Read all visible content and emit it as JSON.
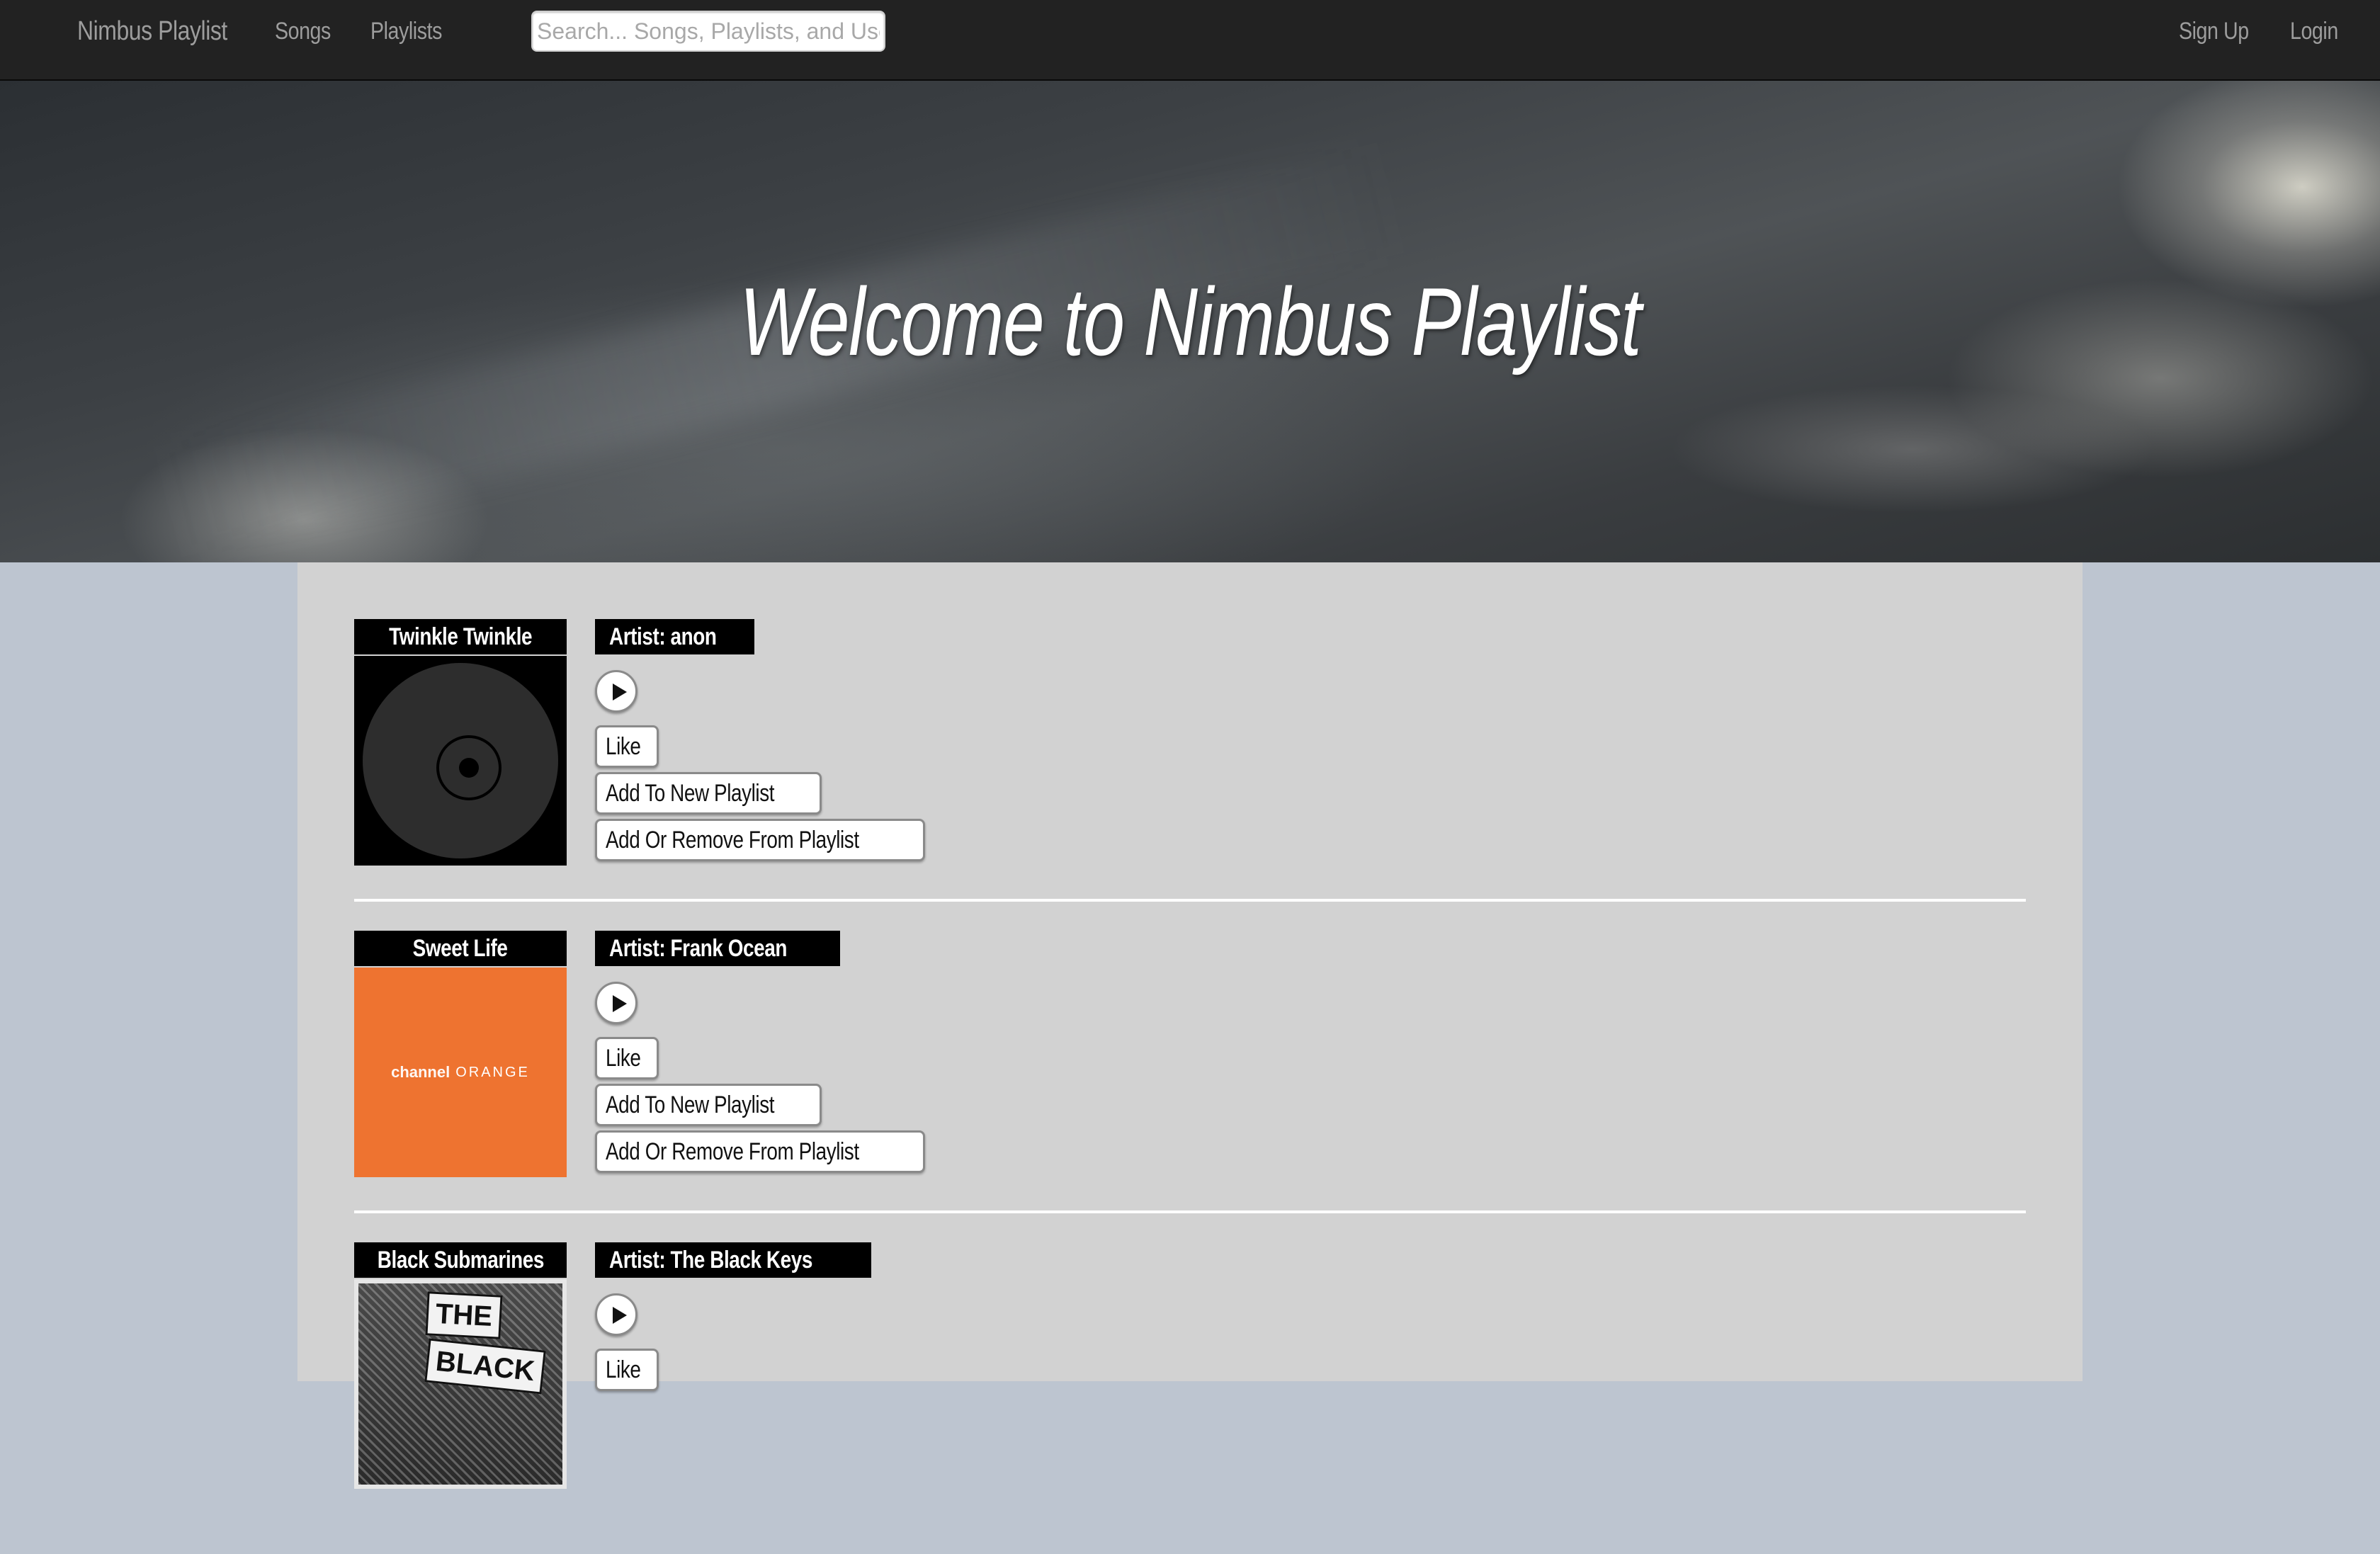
{
  "nav": {
    "brand": "Nimbus Playlist",
    "songs": "Songs",
    "playlists": "Playlists",
    "search_placeholder": "Search... Songs, Playlists, and Users",
    "signup": "Sign Up",
    "login": "Login"
  },
  "hero": {
    "title": "Welcome to Nimbus Playlist"
  },
  "songs": [
    {
      "title": "Twinkle Twinkle",
      "artist": "Artist: anon",
      "cover_icon": "vinyl-record-icon",
      "like": "Like",
      "add_new": "Add To New Playlist",
      "add_remove": "Add Or Remove From Playlist"
    },
    {
      "title": "Sweet Life",
      "artist": "Artist: Frank Ocean",
      "cover_text_bold": "channel",
      "cover_text": "ORANGE",
      "cover_color": "#ee7330",
      "like": "Like",
      "add_new": "Add To New Playlist",
      "add_remove": "Add Or Remove From Playlist"
    },
    {
      "title": "Black Submarines",
      "artist": "Artist: The Black Keys",
      "cover_text_1": "THE",
      "cover_text_2": "BLACK",
      "like": "Like"
    }
  ],
  "colors": {
    "navbar": "#222222",
    "nav_text": "#9d9d9d",
    "page_bg": "#bdc5d0",
    "content_bg": "#d2d2d2",
    "label_bg": "#000000"
  }
}
